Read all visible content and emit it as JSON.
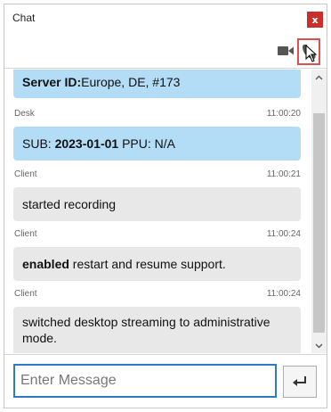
{
  "window": {
    "title": "Chat",
    "close_label": "x"
  },
  "toolbar": {
    "video_icon": "video-camera-icon",
    "call_icon": "phone-icon"
  },
  "messages": [
    {
      "sender": "",
      "time": "",
      "type": "desk",
      "bold": "Server ID:",
      "text": "Europe, DE, #173"
    },
    {
      "sender": "Desk",
      "time": "11:00:20",
      "type": "desk",
      "parts": [
        "SUB: ",
        "2023-01-01",
        " PPU: N/A"
      ]
    },
    {
      "sender": "Client",
      "time": "11:00:21",
      "type": "client",
      "text": "started recording"
    },
    {
      "sender": "Client",
      "time": "11:00:24",
      "type": "client",
      "bold": "enabled",
      "text": " restart and resume support."
    },
    {
      "sender": "Client",
      "time": "11:00:24",
      "type": "client",
      "text": "switched desktop streaming to administrative mode."
    }
  ],
  "composer": {
    "placeholder": "Enter Message",
    "value": "",
    "send_icon": "enter-return-icon"
  },
  "colors": {
    "desk_bubble": "#b3dcf7",
    "client_bubble": "#e8e8e8",
    "close": "#c9302c",
    "input_border": "#2d7bbf"
  }
}
